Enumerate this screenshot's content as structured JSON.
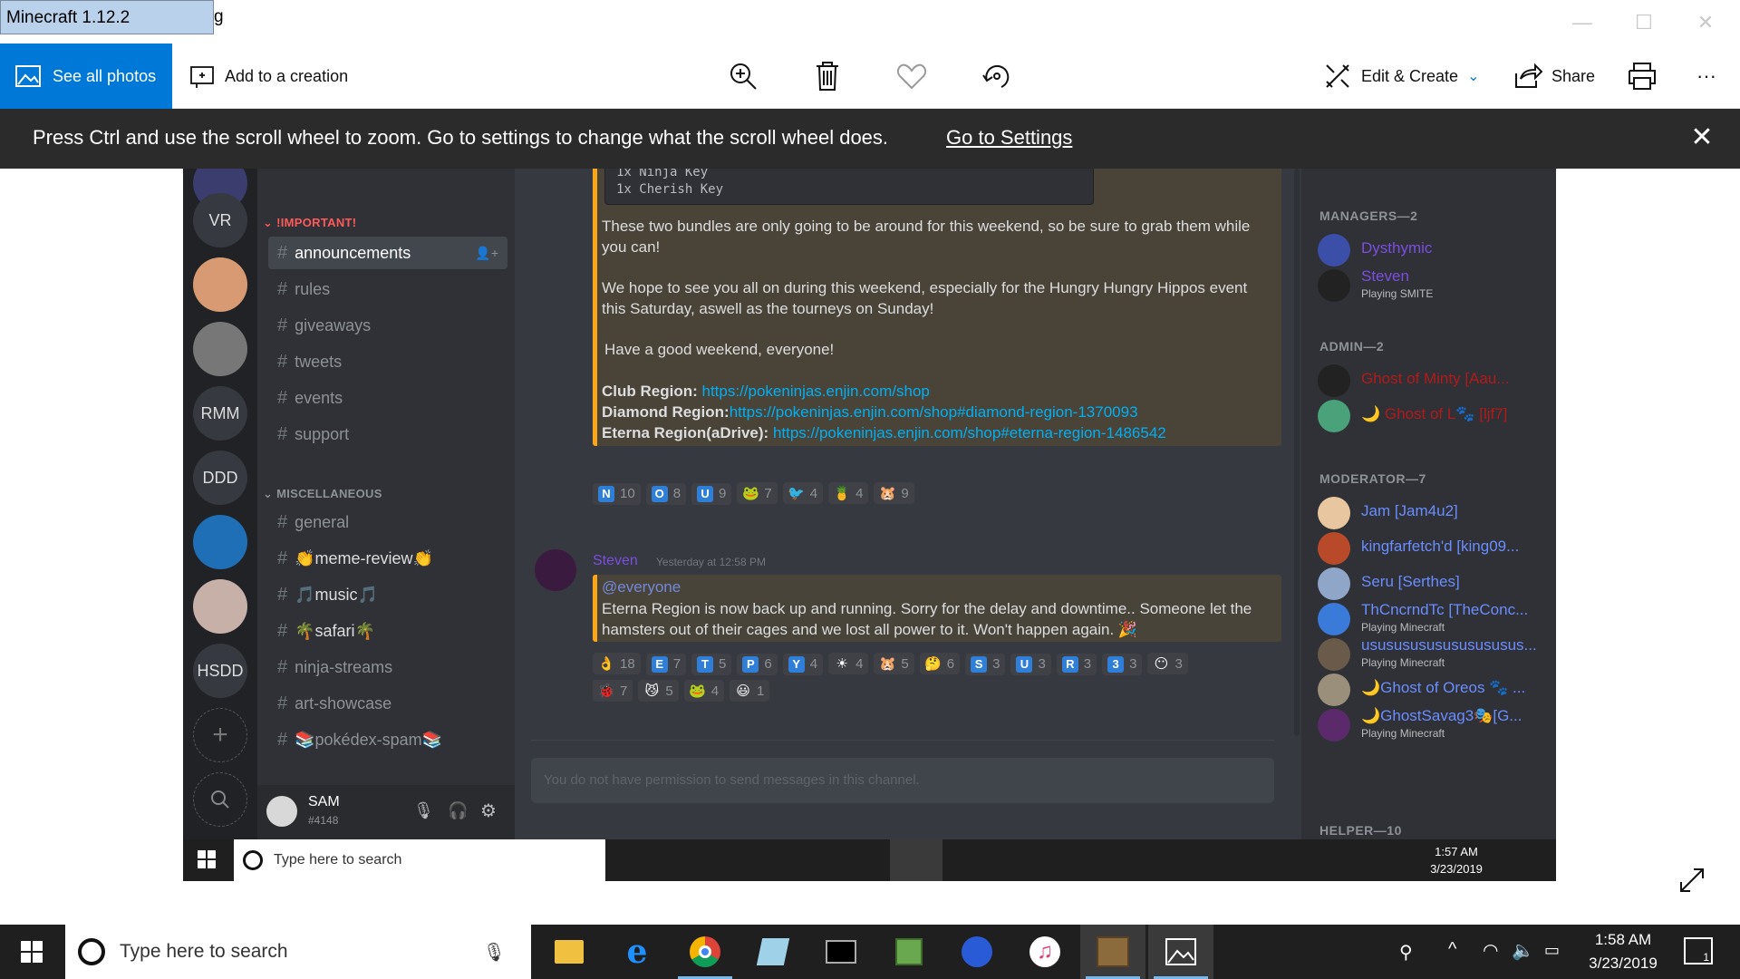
{
  "window": {
    "title": "Minecraft 1.12.2",
    "title_overflow": "g",
    "minimize": "—",
    "maximize": "☐",
    "close": "✕"
  },
  "toolbar": {
    "see_all_photos": "See all photos",
    "add_to_creation": "Add to a creation",
    "edit_create": "Edit & Create",
    "share": "Share",
    "more": "···"
  },
  "notice": {
    "message": "Press Ctrl and use the scroll wheel to zoom. Go to settings to change what the scroll wheel does.",
    "link": "Go to Settings",
    "close": "✕"
  },
  "discord": {
    "servers": [
      "VR",
      "",
      "",
      "RMM",
      "DDD",
      "",
      "",
      "HSDD",
      "+"
    ],
    "categories": {
      "important": "!IMPORTANT!",
      "misc": "MISCELLANEOUS"
    },
    "channels_important": [
      "announcements",
      "rules",
      "giveaways",
      "tweets",
      "events",
      "support"
    ],
    "channels_misc": [
      "general",
      "👏meme-review👏",
      "🎵music🎵",
      "🌴safari🌴",
      "ninja-streams",
      "art-showcase",
      "📚pokédex-spam📚"
    ],
    "user": {
      "name": "SAM",
      "tag": "#4148"
    },
    "code_lines": [
      "1x Ninja Key",
      "1x Cherish Key"
    ],
    "msg1": {
      "p1": "These two bundles are only going to be around for this weekend, so be sure to grab them while you can!",
      "p2": "We hope to see you all on during this weekend, especially for the Hungry Hungry Hippos event this Saturday, aswell as the tourneys on Sunday!",
      "p3": "Have a good weekend, everyone!",
      "club_label": "Club Region:",
      "club_url": "https://pokeninjas.enjin.com/shop",
      "diamond_label": "Diamond Region:",
      "diamond_url": "https://pokeninjas.enjin.com/shop#diamond-region-1370093",
      "eterna_label": "Eterna Region(aDrive):",
      "eterna_url": "https://pokeninjas.enjin.com/shop#eterna-region-1486542"
    },
    "reactions1": [
      {
        "e": "N",
        "n": "10"
      },
      {
        "e": "O",
        "n": "8"
      },
      {
        "e": "U",
        "n": "9"
      },
      {
        "e": "🐸",
        "n": "7"
      },
      {
        "e": "🐦",
        "n": "4"
      },
      {
        "e": "🍍",
        "n": "4"
      },
      {
        "e": "🐹",
        "n": "9"
      }
    ],
    "msg2": {
      "author": "Steven",
      "time": "Yesterday at 12:58 PM",
      "mention": "@everyone",
      "body": "Eterna Region is now back up and running. Sorry for the delay and downtime.. Someone let the hamsters out of their cages and we lost all power to it. Won't happen again. 🎉"
    },
    "reactions2": [
      {
        "e": "👌",
        "n": "18"
      },
      {
        "e": "E",
        "n": "7"
      },
      {
        "e": "T",
        "n": "5"
      },
      {
        "e": "P",
        "n": "6"
      },
      {
        "e": "Y",
        "n": "4"
      },
      {
        "e": "☀",
        "n": "4"
      },
      {
        "e": "🐹",
        "n": "5"
      },
      {
        "e": "🤔",
        "n": "6"
      },
      {
        "e": "S",
        "n": "3"
      },
      {
        "e": "U",
        "n": "3"
      },
      {
        "e": "R",
        "n": "3"
      },
      {
        "e": "3",
        "n": "3"
      },
      {
        "e": "😶",
        "n": "3"
      }
    ],
    "reactions3": [
      {
        "e": "🐞",
        "n": "7"
      },
      {
        "e": "😼",
        "n": "5"
      },
      {
        "e": "🐸",
        "n": "4"
      },
      {
        "e": "😃",
        "n": "1"
      }
    ],
    "input_placeholder": "You do not have permission to send messages in this channel.",
    "members": {
      "managers_header": "MANAGERS—2",
      "admin_header": "ADMIN—2",
      "moderator_header": "MODERATOR—7",
      "helper_header": "HELPER—10",
      "managers": [
        {
          "name": "Dysthymic",
          "status": "",
          "color": "#7b4ee0"
        },
        {
          "name": "Steven",
          "status": "Playing SMITE",
          "color": "#7b4ee0"
        }
      ],
      "admins": [
        {
          "name": "Ghost of Minty [Aau...",
          "status": "",
          "color": "#b21a1a"
        },
        {
          "name": "🌙 Ghost of L🐾 [ljf7]",
          "status": "",
          "color": "#b21a1a"
        }
      ],
      "moderators": [
        {
          "name": "Jam [Jam4u2]",
          "status": "",
          "color": "#6a8dff"
        },
        {
          "name": "kingfarfetch'd [king09...",
          "status": "",
          "color": "#6a8dff"
        },
        {
          "name": "Seru [Serthes]",
          "status": "",
          "color": "#6a8dff"
        },
        {
          "name": "ThCncrndTc [TheConc...",
          "status": "Playing Minecraft",
          "color": "#6a8dff"
        },
        {
          "name": "usususususususususus...",
          "status": "Playing Minecraft",
          "color": "#6a8dff"
        },
        {
          "name": "🌙Ghost of Oreos 🐾 ...",
          "status": "",
          "color": "#6a8dff"
        },
        {
          "name": "🌙GhostSavag3🎭[G...",
          "status": "Playing Minecraft",
          "color": "#6a8dff"
        }
      ]
    },
    "inner_taskbar": {
      "search": "Type here to search",
      "time": "1:57 AM",
      "date": "3/23/2019"
    }
  },
  "taskbar": {
    "search": "Type here to search",
    "time": "1:58 AM",
    "date": "3/23/2019",
    "notif_count": "1"
  },
  "colors": {
    "accent": "#0078d7",
    "discord_bg": "#36393f",
    "embed_border": "#faa61a"
  }
}
